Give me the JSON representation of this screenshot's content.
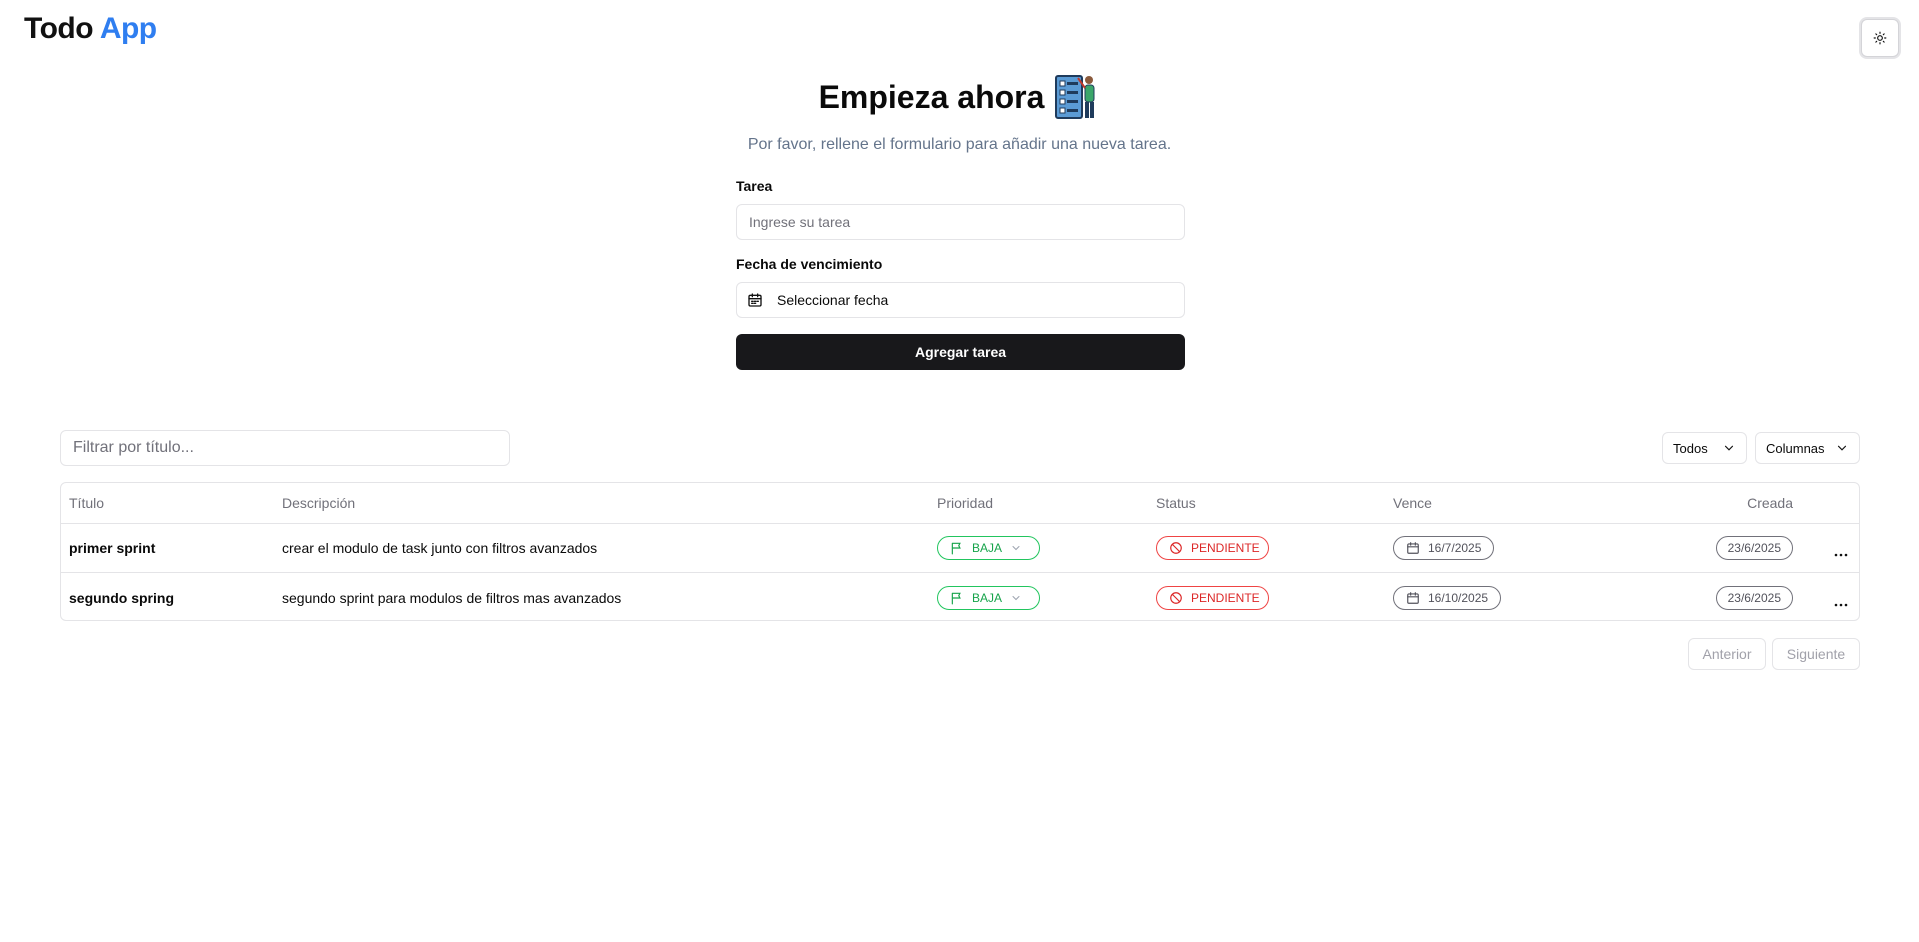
{
  "header": {
    "logo_part1": "Todo",
    "logo_part2": "App",
    "theme_icon": "sun-icon"
  },
  "hero": {
    "title": "Empieza ahora",
    "subtitle": "Por favor, rellene el formulario para añadir una nueva tarea."
  },
  "form": {
    "task_label": "Tarea",
    "task_placeholder": "Ingrese su tarea",
    "task_value": "",
    "due_label": "Fecha de vencimiento",
    "due_button": "Seleccionar fecha",
    "submit": "Agregar tarea"
  },
  "toolbar": {
    "filter_placeholder": "Filtrar por título...",
    "filter_value": "",
    "status_filter": "Todos",
    "columns_button": "Columnas"
  },
  "table": {
    "headers": {
      "title": "Título",
      "description": "Descripción",
      "priority": "Prioridad",
      "status": "Status",
      "due": "Vence",
      "created": "Creada"
    },
    "rows": [
      {
        "title": "primer sprint",
        "description": "crear el modulo de task junto con filtros avanzados",
        "priority": "BAJA",
        "status": "PENDIENTE",
        "due": "16/7/2025",
        "created": "23/6/2025"
      },
      {
        "title": "segundo spring",
        "description": "segundo sprint para modulos de filtros mas avanzados",
        "priority": "BAJA",
        "status": "PENDIENTE",
        "due": "16/10/2025",
        "created": "23/6/2025"
      }
    ]
  },
  "pagination": {
    "prev": "Anterior",
    "next": "Siguiente"
  },
  "colors": {
    "brand_blue": "#2f7ef0",
    "priority_low": "#16a34a",
    "status_pending": "#dc2626",
    "primary_button": "#18181b"
  }
}
